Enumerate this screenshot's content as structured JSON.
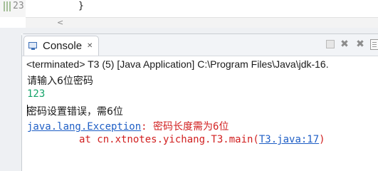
{
  "editor": {
    "line_number": "23",
    "code_line": "}",
    "scroll_left_arrow": "<"
  },
  "console": {
    "tab_label": "Console",
    "tab_close": "✕",
    "description": "<terminated> T3 (5) [Java Application] C:\\Program Files\\Java\\jdk-16.",
    "lines": {
      "prompt": "请输入6位密码",
      "input": "123",
      "error_msg": "密码设置错误，需6位",
      "exception_class": "java.lang.Exception",
      "exception_message": ": 密码长度需为6位",
      "stack_prefix": "at cn.xtnotes.yichang.T3.main(",
      "stack_link": "T3.java:17",
      "stack_suffix": ")"
    }
  },
  "toolbar": {
    "icons": [
      "terminate-icon",
      "remove-launch-icon",
      "remove-all-icon",
      "new-console-icon"
    ]
  },
  "colors": {
    "input_green": "#15a46a",
    "error_red": "#d11f1f",
    "link_blue": "#1f5fc6"
  }
}
